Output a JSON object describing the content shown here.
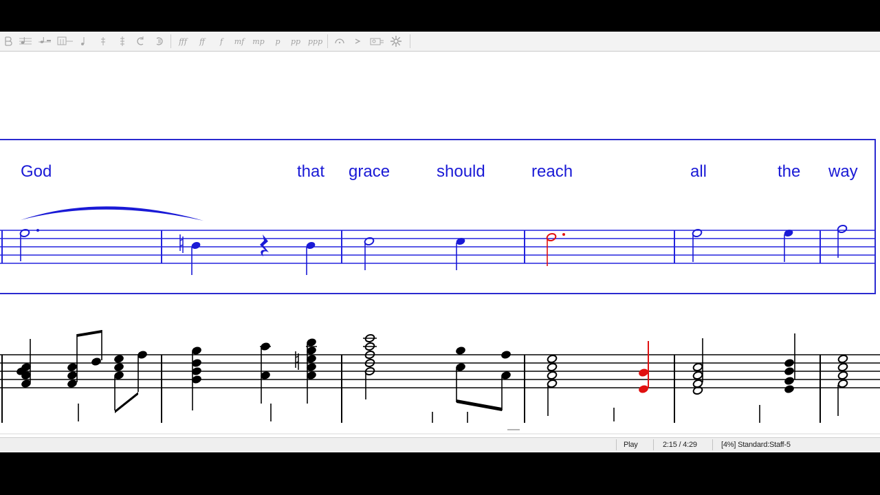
{
  "toolbar": {
    "icons": [
      {
        "name": "select-tool-icon",
        "label": "",
        "interactable": true
      },
      {
        "name": "note-input-icon",
        "label": "",
        "interactable": true
      },
      {
        "name": "rest-input-icon",
        "label": "",
        "interactable": true
      },
      {
        "name": "chord-symbol-icon",
        "label": "",
        "interactable": true
      },
      {
        "name": "voice-one-icon",
        "label": "",
        "interactable": true
      },
      {
        "name": "voice-two-icon",
        "label": "",
        "interactable": true
      },
      {
        "name": "voice-three-icon",
        "label": "",
        "interactable": true
      },
      {
        "name": "repeat-start-icon",
        "label": "",
        "interactable": true
      },
      {
        "name": "repeat-end-icon",
        "label": "",
        "interactable": true
      }
    ],
    "dynamics": [
      "fff",
      "ff",
      "f",
      "mf",
      "mp",
      "p",
      "pp",
      "ppp"
    ],
    "tail_icons": [
      "fermata-icon",
      "accent-icon",
      "mixer-icon",
      "settings-gear-icon"
    ]
  },
  "score": {
    "lyrics": [
      "God",
      "that",
      "grace",
      "should",
      "reach",
      "all",
      "the",
      "way"
    ],
    "colors": {
      "melody": "#1a1ad6",
      "current_note": "#e01010",
      "piano": "#000000",
      "frame": "#2a2ad0"
    }
  },
  "status": {
    "mode": "Play",
    "time": "2:15 / 4:29",
    "staff_info": "[4%] Standard:Staff-5"
  }
}
